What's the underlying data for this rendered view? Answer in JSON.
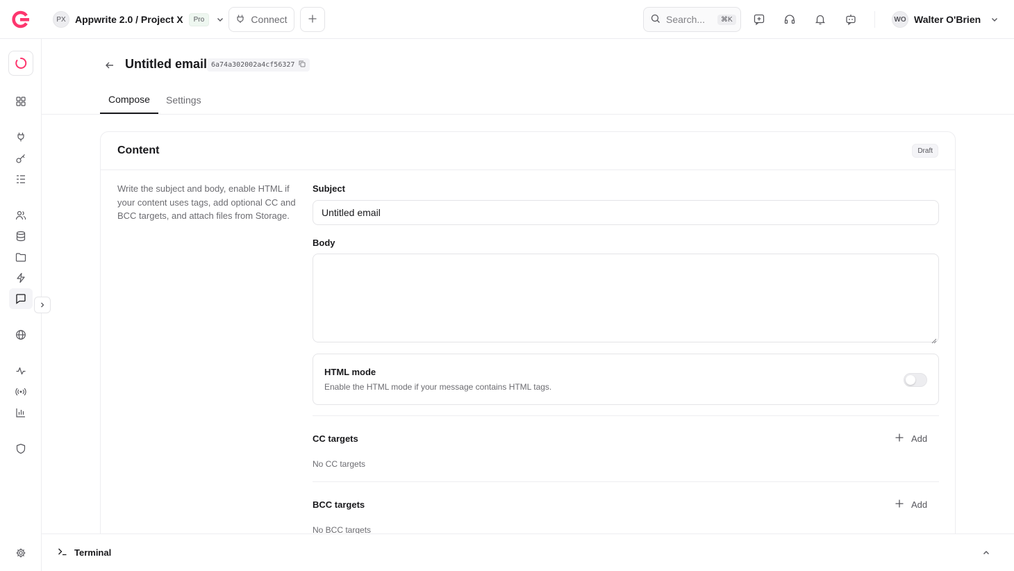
{
  "project": {
    "initials": "PX",
    "name": "Appwrite 2.0 / Project X",
    "plan": "Pro"
  },
  "topbar": {
    "connect_label": "Connect",
    "search_placeholder": "Search...",
    "search_shortcut": "⌘K"
  },
  "user": {
    "initials": "WO",
    "name": "Walter O'Brien"
  },
  "page": {
    "title": "Untitled email",
    "id": "6a74a302002a4cf56327"
  },
  "tabs": [
    {
      "label": "Compose",
      "active": true
    },
    {
      "label": "Settings",
      "active": false
    }
  ],
  "card": {
    "title": "Content",
    "status": "Draft",
    "description": "Write the subject and body, enable HTML if your content uses tags, add optional CC and BCC targets, and attach files from Storage.",
    "subject_label": "Subject",
    "subject_value": "Untitled email",
    "body_label": "Body",
    "html_mode": {
      "title": "HTML mode",
      "description": "Enable the HTML mode if your message contains HTML tags.",
      "enabled": false
    },
    "cc": {
      "title": "CC targets",
      "add_label": "Add",
      "empty": "No CC targets"
    },
    "bcc": {
      "title": "BCC targets",
      "add_label": "Add",
      "empty": "No BCC targets"
    }
  },
  "terminal": {
    "label": "Terminal"
  },
  "colors": {
    "accent": "#fd366e",
    "text": "#19191c",
    "muted": "#6c6c71",
    "border": "#ededf0"
  }
}
